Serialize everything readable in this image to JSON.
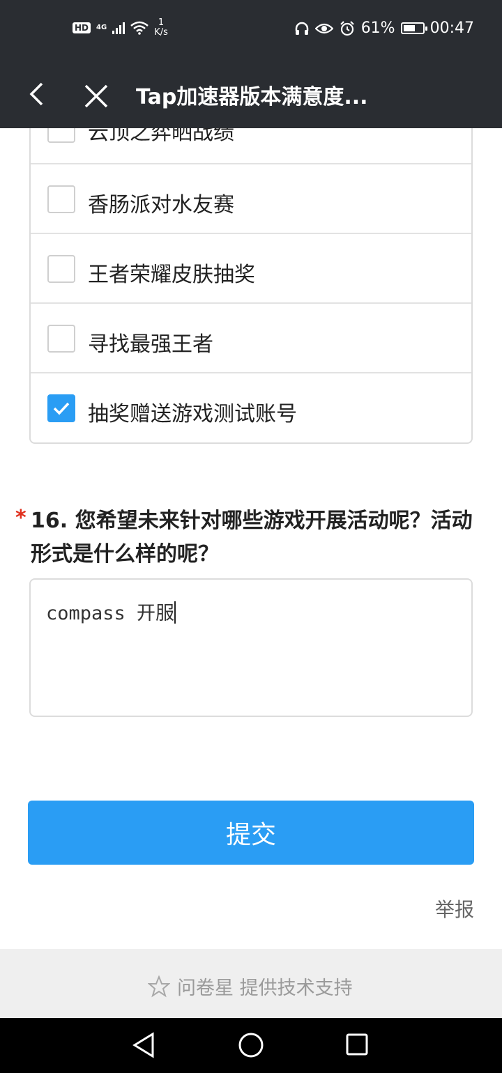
{
  "status_bar": {
    "hd": "HD",
    "network": "4G",
    "speed_value": "1",
    "speed_unit": "K/s",
    "battery": "61%",
    "time": "00:47",
    "battery_level": 0.61
  },
  "nav": {
    "title": "Tap加速器版本满意度..."
  },
  "options": [
    {
      "label": "云顶之弈晒战绩",
      "checked": false
    },
    {
      "label": "香肠派对水友赛",
      "checked": false
    },
    {
      "label": "王者荣耀皮肤抽奖",
      "checked": false
    },
    {
      "label": "寻找最强王者",
      "checked": false
    },
    {
      "label": "抽奖赠送游戏测试账号",
      "checked": true
    }
  ],
  "question": {
    "required_mark": "*",
    "title": "16. 您希望未来针对哪些游戏开展活动呢？活动形式是什么样的呢？",
    "answer": "compass 开服"
  },
  "submit_label": "提交",
  "report_label": "举报",
  "footer": {
    "text": "问卷星 提供技术支持"
  },
  "colors": {
    "accent": "#2a9df4",
    "required": "#e0301e",
    "header_bg": "#2a2d32"
  }
}
